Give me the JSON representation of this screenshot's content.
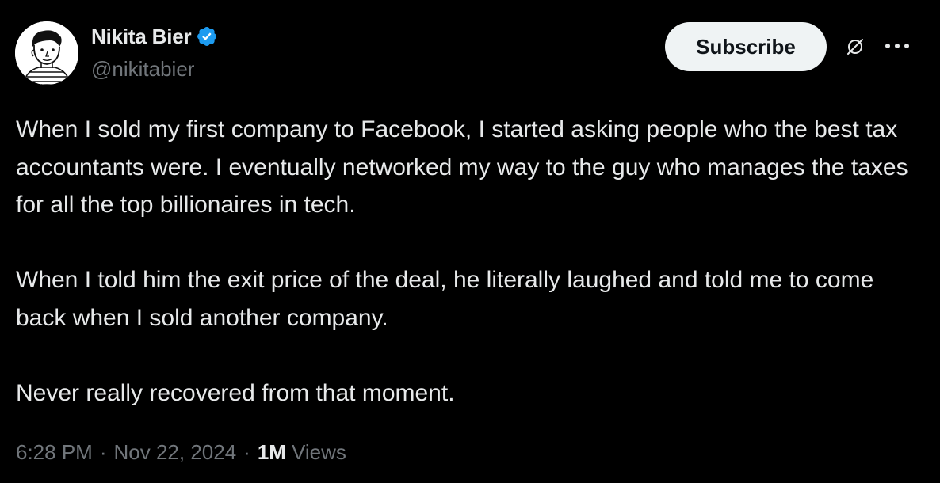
{
  "author": {
    "display_name": "Nikita Bier",
    "handle": "@nikitabier",
    "verified": true,
    "verified_color": "#1d9bf0",
    "avatar_icon": "cartoon-avatar"
  },
  "actions": {
    "subscribe_label": "Subscribe",
    "grok_icon": "grok-icon",
    "more_icon": "more-icon"
  },
  "tweet": {
    "paragraphs": [
      "When I sold my first company to Facebook, I started asking people who the best tax accountants were. I eventually networked my way to the guy who manages the taxes for all the top billionaires in tech.",
      "When I told him the exit price of the deal, he literally laughed and told me to come back when I sold another company.",
      "Never really recovered from that moment."
    ]
  },
  "meta": {
    "time": "6:28 PM",
    "separator": "·",
    "date": "Nov 22, 2024",
    "views_count": "1M",
    "views_label": "Views"
  },
  "colors": {
    "background": "#000000",
    "text_primary": "#e7e9ea",
    "text_secondary": "#71767b",
    "button_bg": "#eff3f4"
  }
}
